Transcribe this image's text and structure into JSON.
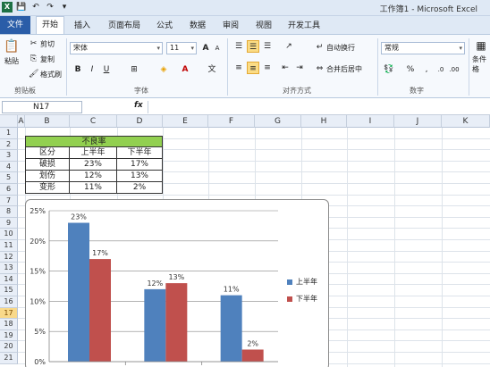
{
  "titlebar": {
    "window_title": "工作簿1 - Microsoft Excel",
    "qat": [
      "X",
      "💾",
      "↶",
      "↷",
      "▾"
    ]
  },
  "tabs": {
    "file": "文件",
    "items": [
      "开始",
      "插入",
      "页面布局",
      "公式",
      "数据",
      "审阅",
      "视图",
      "开发工具"
    ],
    "active": "开始"
  },
  "ribbon": {
    "clipboard": {
      "paste": "粘贴",
      "cut": "剪切",
      "copy": "复制",
      "format_painter": "格式刷",
      "label": "剪贴板"
    },
    "font": {
      "name": "宋体",
      "size": "11",
      "bold": "B",
      "italic": "I",
      "underline": "U",
      "grow": "A",
      "shrink": "A",
      "label": "字体"
    },
    "alignment": {
      "wrap": "自动换行",
      "merge": "合并后居中",
      "label": "对齐方式"
    },
    "number": {
      "format": "常规",
      "percent": "%",
      "comma": ",",
      "label": "数字"
    },
    "styles": {
      "cond_format": "条件格"
    }
  },
  "formula_bar": {
    "name_box": "N17",
    "fx": "fx",
    "content": ""
  },
  "columns": [
    "A",
    "B",
    "C",
    "D",
    "E",
    "F",
    "G",
    "H",
    "I",
    "J",
    "K"
  ],
  "rows": [
    "1",
    "2",
    "3",
    "4",
    "5",
    "6",
    "7",
    "8",
    "9",
    "10",
    "11",
    "12",
    "13",
    "14",
    "15",
    "16",
    "17",
    "18",
    "19",
    "20",
    "21"
  ],
  "selected_row": "17",
  "table": {
    "title": "不良率",
    "header": [
      "区分",
      "上半年",
      "下半年"
    ],
    "rows": [
      [
        "破损",
        "23%",
        "17%"
      ],
      [
        "划伤",
        "12%",
        "13%"
      ],
      [
        "变形",
        "11%",
        "2%"
      ]
    ]
  },
  "chart_data": {
    "type": "bar",
    "categories": [
      "破损",
      "划伤",
      "变形"
    ],
    "series": [
      {
        "name": "上半年",
        "values": [
          23,
          12,
          11
        ],
        "color": "#4f81bd"
      },
      {
        "name": "下半年",
        "values": [
          17,
          13,
          2
        ],
        "color": "#c0504d"
      }
    ],
    "y_ticks": [
      "0%",
      "5%",
      "10%",
      "15%",
      "20%",
      "25%"
    ],
    "ylim": [
      0,
      25
    ],
    "data_labels": [
      "23%",
      "17%",
      "12%",
      "13%",
      "11%",
      "2%"
    ],
    "legend_position": "right",
    "grid": true
  }
}
